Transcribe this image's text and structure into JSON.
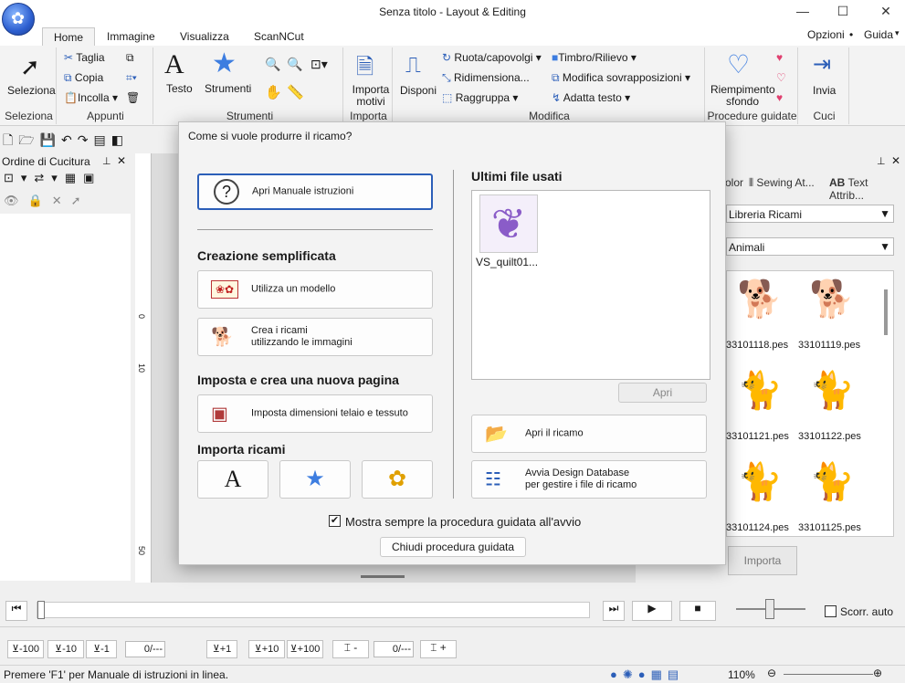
{
  "window": {
    "title": "Senza titolo - Layout & Editing"
  },
  "tabs": [
    "Home",
    "Immagine",
    "Visualizza",
    "ScanNCut"
  ],
  "topright": {
    "options": "Opzioni",
    "guide": "Guida"
  },
  "ribbon": {
    "seleziona": {
      "button": "Seleziona",
      "group": "Seleziona"
    },
    "appunti": {
      "taglia": "Taglia",
      "copia": "Copia",
      "incolla": "Incolla",
      "group": "Appunti"
    },
    "strumenti": {
      "testo": "Testo",
      "strumenti": "Strumenti",
      "group": "Strumenti"
    },
    "importa": {
      "button": "Importa motivi",
      "group": "Importa"
    },
    "modifica": {
      "disponi": "Disponi",
      "ruota": "Ruota/capovolgi",
      "ridimensiona": "Ridimensiona...",
      "raggruppa": "Raggruppa",
      "timbro": "Timbro/Rilievo",
      "sovrapposizioni": "Modifica sovrapposizioni",
      "adatta": "Adatta testo",
      "group": "Modifica"
    },
    "guidate": {
      "riempimento": "Riempimento sfondo",
      "group": "Procedure guidate"
    },
    "cuci": {
      "invia": "Invia",
      "group": "Cuci"
    }
  },
  "left_panel": {
    "title": "Ordine di Cucitura"
  },
  "right_panel": {
    "tabs": [
      "olor",
      "Sewing At...",
      "Text Attrib..."
    ],
    "library": "Libreria Ricami",
    "category": "Animali",
    "items": [
      "33101118.pes",
      "33101119.pes",
      "33101121.pes",
      "33101122.pes",
      "33101124.pes",
      "33101125.pes"
    ],
    "import": "Importa"
  },
  "ruler": {
    "marks": [
      "0",
      "10",
      "50"
    ]
  },
  "dialog": {
    "title": "Come si vuole produrre il ricamo?",
    "manual": "Apri Manuale istruzioni",
    "section1": "Creazione semplificata",
    "use_template": "Utilizza un modello",
    "create_images": "Crea i ricami\n utilizzando le immagini",
    "section2": "Imposta e crea una nuova pagina",
    "set_frame": "Imposta dimensioni telaio e tessuto",
    "section3": "Importa ricami",
    "recent_title": "Ultimi file usati",
    "recent_file": "VS_quilt01...",
    "open": "Apri",
    "open_embroidery": "Apri il ricamo",
    "design_db": "Avvia Design Database\n per gestire i file di ricamo",
    "always_show": "Mostra sempre la procedura guidata all'avvio",
    "close": "Chiudi procedura guidata"
  },
  "sim": {
    "auto_scroll": "Scorr. auto"
  },
  "stitch_buttons": [
    "-100",
    "-10",
    "-1",
    "+1",
    "+10",
    "+100"
  ],
  "stitch_counters": [
    "0/---",
    "0/---"
  ],
  "status": {
    "message": "Premere 'F1' per Manuale di istruzioni in linea.",
    "zoom": "110%"
  }
}
